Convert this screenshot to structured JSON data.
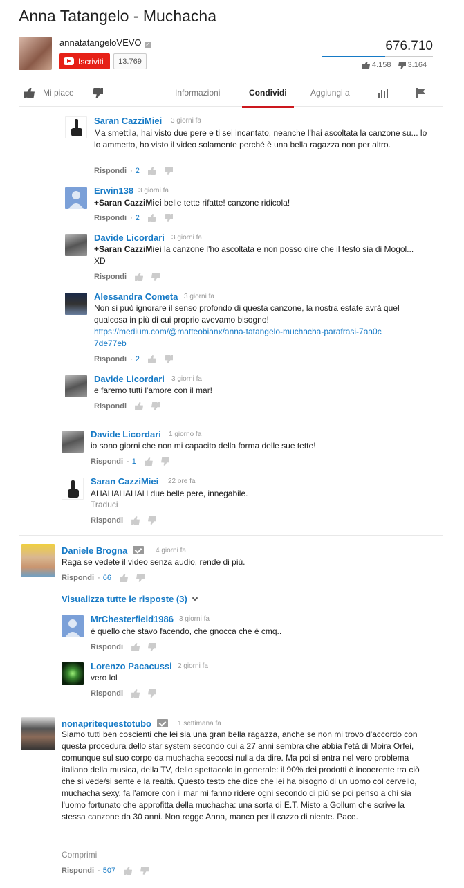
{
  "video": {
    "title": "Anna Tatangelo - Muchacha",
    "channel": "annatatangeloVEVO",
    "subscribe_label": "Iscriviti",
    "subscriber_count": "13.769",
    "views": "676.710",
    "likes": "4.158",
    "dislikes": "3.164",
    "like_ratio": 0.57
  },
  "actions": {
    "like_label": "Mi piace",
    "tabs": [
      "Informazioni",
      "Condividi",
      "Aggiungi a"
    ],
    "active_tab": "Condividi"
  },
  "labels": {
    "reply": "Rispondi",
    "translate": "Traduci",
    "view_all_replies": "Visualizza tutte le risposte (3)",
    "read_less": "Comprimi"
  },
  "comments": [
    {
      "author": "Saran CazziMiei",
      "time": "3 giorni fa",
      "text": "Ma smettila, hai visto due pere e ti sei incantato, neanche l'hai ascoltata la canzone su... lo lo ammetto, ho visto il video solamente perché è una bella ragazza non per altro.",
      "likes": "2"
    },
    {
      "author": "Erwin138",
      "time": "3 giorni fa",
      "mention": "+Saran CazziMiei",
      "text": " belle tette rifatte! canzone ridicola!",
      "likes": "2"
    },
    {
      "author": "Davide Licordari",
      "time": "3 giorni fa",
      "mention": "+Saran CazziMiei",
      "text": " la canzone l'ho ascoltata e non posso dire che il testo sia di Mogol... XD",
      "likes": ""
    },
    {
      "author": "Alessandra Cometa",
      "time": "3 giorni fa",
      "text": "Non si può ignorare il senso profondo di questa canzone, la nostra estate avrà quel qualcosa in più di cui proprio avevamo bisogno!",
      "link": "https://medium.com/@matteobianx/anna-tatangelo-muchacha-parafrasi-7aa0c7de77eb",
      "likes": "2"
    },
    {
      "author": "Davide Licordari",
      "time": "3 giorni fa",
      "text": "e faremo tutti l'amore con il mar!",
      "likes": ""
    },
    {
      "author": "Davide Licordari",
      "time": "1 giorno fa",
      "text": "io sono giorni che non mi capacito della forma delle sue tette!",
      "likes": "1"
    },
    {
      "author": "Saran CazziMiei",
      "time": "22 ore fa",
      "text": "AHAHAHAHAH due belle pere, innegabile.",
      "likes": ""
    },
    {
      "author": "Daniele Brogna",
      "time": "4 giorni fa",
      "text": "Raga se vedete il video senza audio, rende di più.",
      "likes": "66"
    },
    {
      "author": "MrChesterfield1986",
      "time": "3 giorni fa",
      "text": "è quello che stavo facendo, che gnocca che è cmq..",
      "likes": ""
    },
    {
      "author": "Lorenzo Pacacussi",
      "time": "2 giorni fa",
      "text": "vero lol",
      "likes": ""
    },
    {
      "author": "nonapritequestotubo",
      "time": "1 settimana fa",
      "text": "Siamo tutti ben coscienti che lei sia una gran bella ragazza, anche se non mi trovo d'accordo con questa procedura dello star system secondo cui a 27 anni sembra che abbia l'età di Moira Orfei, comunque sul suo corpo da muchacha secccsi nulla da dire. Ma poi si entra nel vero problema italiano della musica, della TV, dello spettacolo in generale: il 90% dei prodotti è incoerente tra ciò che si vede/si sente e la realtà. Questo testo che dice che lei ha bisogno di un uomo col cervello, muchacha sexy, fa l'amore con il mar mi fanno ridere ogni secondo di più se poi penso a chi sia l'uomo fortunato che approfitta della muchacha: una sorta di E.T. Misto a Gollum che scrive la stessa canzone da 30 anni. Non regge Anna, manco per il cazzo di niente. Pace.",
      "likes": "507"
    }
  ]
}
